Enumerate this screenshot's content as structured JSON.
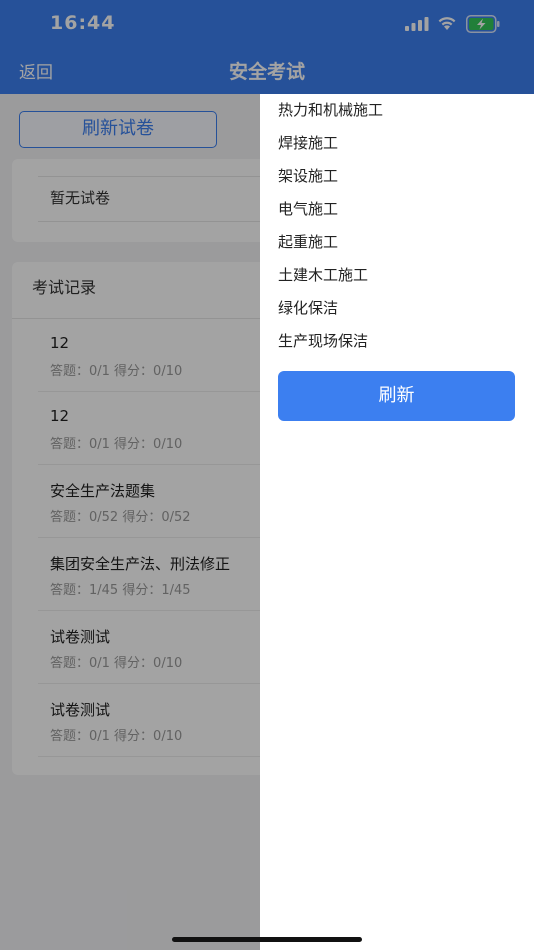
{
  "status_bar": {
    "time": "16:44"
  },
  "nav": {
    "back_label": "返回",
    "title": "安全考试"
  },
  "main": {
    "refresh_paper_label": "刷新试卷",
    "empty_paper_text": "暂无试卷",
    "records_title": "考试记录",
    "records": [
      {
        "name": "12",
        "meta": "答题：0/1 得分：0/10"
      },
      {
        "name": "12",
        "meta": "答题：0/1 得分：0/10"
      },
      {
        "name": "安全生产法题集",
        "meta": "答题：0/52 得分：0/52"
      },
      {
        "name": "集团安全生产法、刑法修正",
        "meta": "答题：1/45 得分：1/45"
      },
      {
        "name": "试卷测试",
        "meta": "答题：0/1 得分：0/10"
      },
      {
        "name": "试卷测试",
        "meta": "答题：0/1 得分：0/10"
      }
    ]
  },
  "drawer": {
    "items": [
      {
        "label": "热力和机械施工"
      },
      {
        "label": "焊接施工"
      },
      {
        "label": "架设施工"
      },
      {
        "label": "电气施工"
      },
      {
        "label": "起重施工"
      },
      {
        "label": "土建木工施工"
      },
      {
        "label": "绿化保洁"
      },
      {
        "label": "生产现场保洁"
      }
    ],
    "refresh_label": "刷新"
  },
  "colors": {
    "accent": "#3c7ff0",
    "battery": "#34c759"
  },
  "icons": [
    "signal-icon",
    "wifi-icon",
    "battery-charging-icon"
  ]
}
